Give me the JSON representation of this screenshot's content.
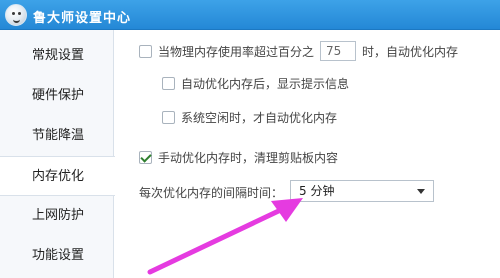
{
  "window": {
    "title": "鲁大师设置中心",
    "icon": "ludashi-logo-icon"
  },
  "sidebar": {
    "items": [
      {
        "label": "常规设置",
        "active": false
      },
      {
        "label": "硬件保护",
        "active": false
      },
      {
        "label": "节能降温",
        "active": false
      },
      {
        "label": "内存优化",
        "active": true
      },
      {
        "label": "上网防护",
        "active": false
      },
      {
        "label": "功能设置",
        "active": false
      }
    ]
  },
  "memory": {
    "auto_optimize_prefix": "当物理内存使用率超过百分之",
    "threshold_value": "75",
    "auto_optimize_suffix": "时，自动优化内存",
    "auto_optimize_checked": false,
    "show_tip_label": "自动优化内存后，显示提示信息",
    "show_tip_checked": false,
    "idle_only_label": "系统空闲时，才自动优化内存",
    "idle_only_checked": false,
    "clear_clipboard_label": "手动优化内存时，清理剪贴板内容",
    "clear_clipboard_checked": true,
    "interval_label": "每次优化内存的间隔时间：",
    "interval_value": "5 分钟"
  },
  "annotation": {
    "arrow_color": "#e53be0"
  }
}
